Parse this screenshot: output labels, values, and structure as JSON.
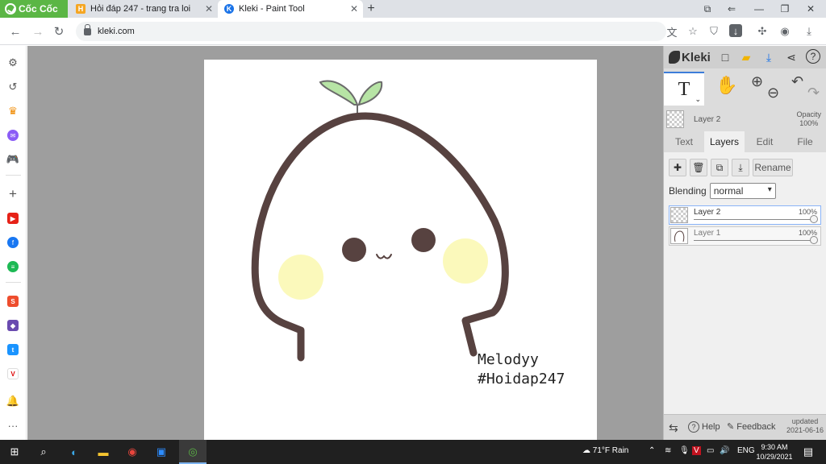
{
  "browser": {
    "brand": "Cốc Cốc",
    "tabs": [
      {
        "title": "Hỏi đáp 247 - trang tra loi",
        "favicon": "H"
      },
      {
        "title": "Kleki - Paint Tool",
        "favicon": "K",
        "active": true
      }
    ],
    "url": "kleki.com"
  },
  "canvas": {
    "signature_line1": "Melodyy",
    "signature_line2": "#Hoidap247"
  },
  "kleki": {
    "logo": "Kleki",
    "tool_glyph": "T",
    "layer_name": "Layer 2",
    "opacity_label": "Opacity",
    "opacity_value": "100%",
    "tabs": [
      "Text",
      "Layers",
      "Edit",
      "File"
    ],
    "active_tab": "Layers",
    "rename_label": "Rename",
    "blending_label": "Blending",
    "blending_value": "normal",
    "layers": [
      {
        "name": "Layer 2",
        "opacity": "100%",
        "selected": true
      },
      {
        "name": "Layer 1",
        "opacity": "100%",
        "selected": false
      }
    ],
    "footer": {
      "help": "Help",
      "feedback": "Feedback",
      "updated_label": "updated",
      "updated_date": "2021-06-16"
    }
  },
  "taskbar": {
    "weather": "71°F  Rain",
    "language": "ENG",
    "time": "9:30 AM",
    "date": "10/29/2021"
  },
  "colors": {
    "brand_green": "#5bb645",
    "accent_blue": "#3c7dd9",
    "outline_brown": "#574240",
    "leaf_green": "#b7e4a5",
    "blush_yellow": "#fbf8b4"
  }
}
